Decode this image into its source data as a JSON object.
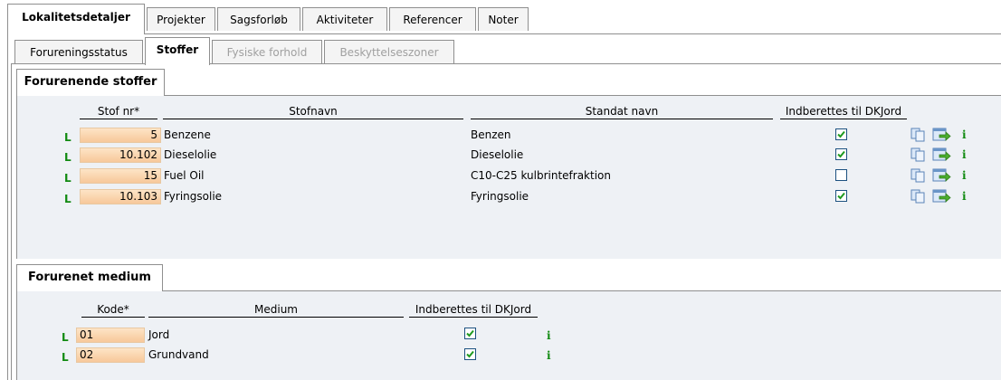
{
  "main_tabs": [
    "Lokalitetsdetaljer",
    "Projekter",
    "Sagsforløb",
    "Aktiviteter",
    "Referencer",
    "Noter"
  ],
  "sub_tabs": [
    "Forureningsstatus",
    "Stoffer",
    "Fysiske forhold",
    "Beskyttelseszoner"
  ],
  "stoffer": {
    "title": "Forurenende stoffer",
    "headers": {
      "stof_nr": "Stof nr*",
      "stofnavn": "Stofnavn",
      "standat_navn": "Standat navn",
      "dkjord": "Indberettes til DKJord"
    },
    "rows": [
      {
        "flag": "L",
        "nr": "5",
        "navn": "Benzene",
        "standat": "Benzen",
        "dkjord": true,
        "info": "i"
      },
      {
        "flag": "L",
        "nr": "10.102",
        "navn": "Dieselolie",
        "standat": "Dieselolie",
        "dkjord": true,
        "info": "i"
      },
      {
        "flag": "L",
        "nr": "15",
        "navn": "Fuel Oil",
        "standat": "C10-C25 kulbrintefraktion",
        "dkjord": false,
        "info": "i"
      },
      {
        "flag": "L",
        "nr": "10.103",
        "navn": "Fyringsolie",
        "standat": "Fyringsolie",
        "dkjord": true,
        "info": "i"
      }
    ]
  },
  "medium": {
    "title": "Forurenet medium",
    "headers": {
      "kode": "Kode*",
      "medium": "Medium",
      "dkjord": "Indberettes til DKJord"
    },
    "rows": [
      {
        "flag": "L",
        "kode": "01",
        "medium": "Jord",
        "dkjord": true,
        "info": "i"
      },
      {
        "flag": "L",
        "kode": "02",
        "medium": "Grundvand",
        "dkjord": true,
        "info": "i"
      }
    ]
  },
  "icons": [
    "copy-icon",
    "goto-icon",
    "info-icon"
  ],
  "colors": {
    "flag_green": "#118a11",
    "input_orange": "#f7c89a",
    "panel_bg": "#eef1f5",
    "check_green": "#1f9a1f"
  }
}
